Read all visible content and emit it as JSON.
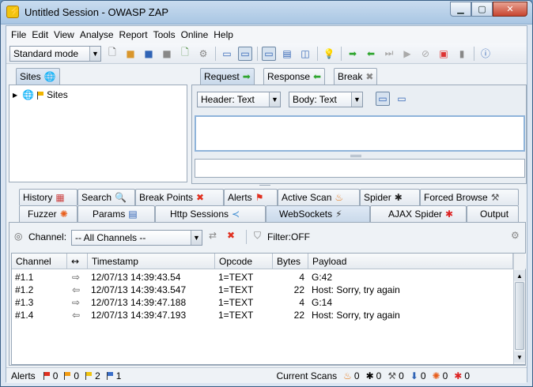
{
  "window": {
    "title": "Untitled Session - OWASP ZAP",
    "controls": {
      "minimize": "▁",
      "maximize": "▢",
      "close": "✕"
    }
  },
  "menu": [
    "File",
    "Edit",
    "View",
    "Analyse",
    "Report",
    "Tools",
    "Online",
    "Help"
  ],
  "toolbar": {
    "mode": "Standard mode"
  },
  "sites_panel": {
    "tab": "Sites",
    "tree_root": "Sites"
  },
  "request_panel": {
    "tabs": [
      "Request",
      "Response",
      "Break"
    ],
    "header_view": "Header: Text",
    "body_view": "Body: Text"
  },
  "bottom_tabs": {
    "row1": [
      "History",
      "Search",
      "Break Points",
      "Alerts",
      "Active Scan",
      "Spider",
      "Forced Browse"
    ],
    "row2": [
      "Fuzzer",
      "Params",
      "Http Sessions",
      "WebSockets",
      "AJAX Spider",
      "Output"
    ]
  },
  "websockets": {
    "channel_label": "Channel:",
    "channel_value": "-- All Channels --",
    "filter_label": "Filter:OFF",
    "columns": [
      "Channel",
      "↔",
      "Timestamp",
      "Opcode",
      "Bytes",
      "Payload"
    ],
    "rows": [
      {
        "channel": "#1.1",
        "dir": "⇨",
        "timestamp": "12/07/13 14:39:43.54",
        "opcode": "1=TEXT",
        "bytes": "4",
        "payload": "G:42"
      },
      {
        "channel": "#1.2",
        "dir": "⇦",
        "timestamp": "12/07/13 14:39:43.547",
        "opcode": "1=TEXT",
        "bytes": "22",
        "payload": "Host: Sorry, try again"
      },
      {
        "channel": "#1.3",
        "dir": "⇨",
        "timestamp": "12/07/13 14:39:47.188",
        "opcode": "1=TEXT",
        "bytes": "4",
        "payload": "G:14"
      },
      {
        "channel": "#1.4",
        "dir": "⇦",
        "timestamp": "12/07/13 14:39:47.193",
        "opcode": "1=TEXT",
        "bytes": "22",
        "payload": "Host: Sorry, try again"
      }
    ]
  },
  "status": {
    "alerts_label": "Alerts",
    "alert_counts": [
      "0",
      "0",
      "2",
      "1"
    ],
    "alert_colors": [
      "#e03020",
      "#f39c12",
      "#f1c40f",
      "#3a6fc9"
    ],
    "scans_label": "Current Scans",
    "scan_counts": [
      "0",
      "0",
      "0",
      "0",
      "0",
      "0"
    ]
  }
}
